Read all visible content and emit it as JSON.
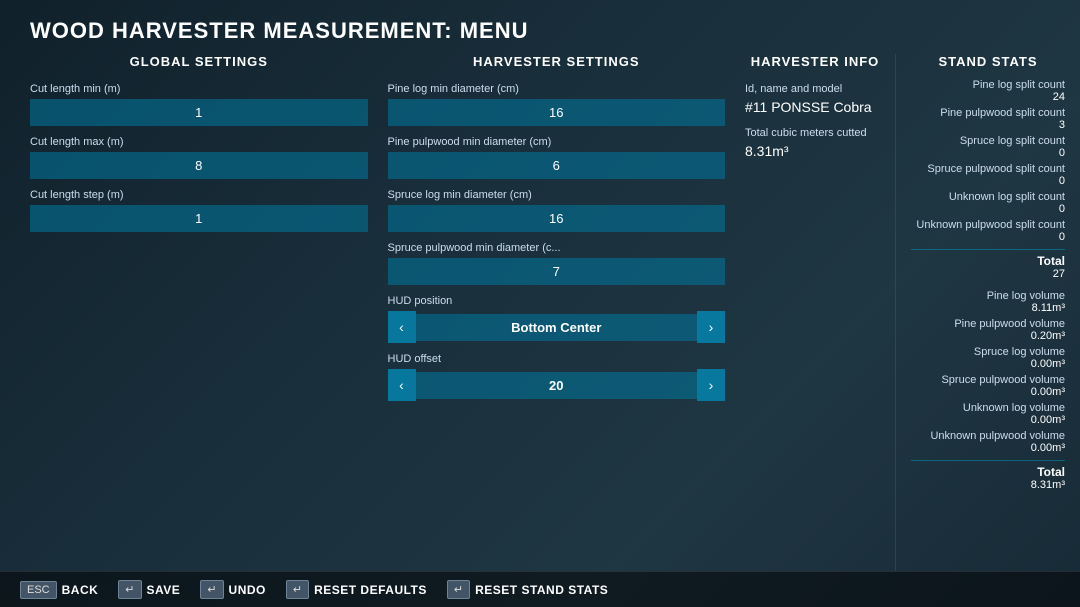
{
  "title": "WOOD HARVESTER MEASUREMENT: MENU",
  "globalSettings": {
    "sectionTitle": "GLOBAL SETTINGS",
    "fields": [
      {
        "label": "Cut length min (m)",
        "value": "1"
      },
      {
        "label": "Cut length max (m)",
        "value": "8"
      },
      {
        "label": "Cut length step (m)",
        "value": "1"
      }
    ]
  },
  "harvesterSettings": {
    "sectionTitle": "HARVESTER SETTINGS",
    "fields": [
      {
        "label": "Pine log min diameter (cm)",
        "value": "16"
      },
      {
        "label": "Pine pulpwood min diameter (cm)",
        "value": "6"
      },
      {
        "label": "Spruce log min diameter (cm)",
        "value": "16"
      },
      {
        "label": "Spruce pulpwood min diameter (c...",
        "value": "7"
      }
    ],
    "hudPosition": {
      "label": "HUD position",
      "value": "Bottom Center",
      "prevIcon": "‹",
      "nextIcon": "›"
    },
    "hudOffset": {
      "label": "HUD offset",
      "value": "20",
      "prevIcon": "‹",
      "nextIcon": "›"
    }
  },
  "harvesterInfo": {
    "sectionTitle": "HARVESTER INFO",
    "idLabel": "Id, name and model",
    "idValue": "#11 PONSSE Cobra",
    "cubicLabel": "Total cubic meters cutted",
    "cubicValue": "8.31m³"
  },
  "standStats": {
    "sectionTitle": "STAND STATS",
    "splitCounts": [
      {
        "label": "Pine log split count",
        "value": "24"
      },
      {
        "label": "Pine pulpwood split count",
        "value": "3"
      },
      {
        "label": "Spruce log split count",
        "value": "0"
      },
      {
        "label": "Spruce pulpwood split count",
        "value": "0"
      },
      {
        "label": "Unknown log split count",
        "value": "0"
      },
      {
        "label": "Unknown pulpwood split count",
        "value": "0"
      }
    ],
    "splitTotal": {
      "label": "Total",
      "value": "27"
    },
    "volumes": [
      {
        "label": "Pine log volume",
        "value": "8.11m³"
      },
      {
        "label": "Pine pulpwood volume",
        "value": "0.20m³"
      },
      {
        "label": "Spruce log volume",
        "value": "0.00m³"
      },
      {
        "label": "Spruce pulpwood volume",
        "value": "0.00m³"
      },
      {
        "label": "Unknown log volume",
        "value": "0.00m³"
      },
      {
        "label": "Unknown pulpwood volume",
        "value": "0.00m³"
      }
    ],
    "volumeTotal": {
      "label": "Total",
      "value": "8.31m³"
    }
  },
  "bottomBar": {
    "buttons": [
      {
        "key": "ESC",
        "label": "BACK"
      },
      {
        "key": "↵",
        "label": "SAVE"
      },
      {
        "key": "↵",
        "label": "UNDO"
      },
      {
        "key": "↵",
        "label": "RESET DEFAULTS"
      },
      {
        "key": "↵",
        "label": "RESET STAND STATS"
      }
    ]
  }
}
